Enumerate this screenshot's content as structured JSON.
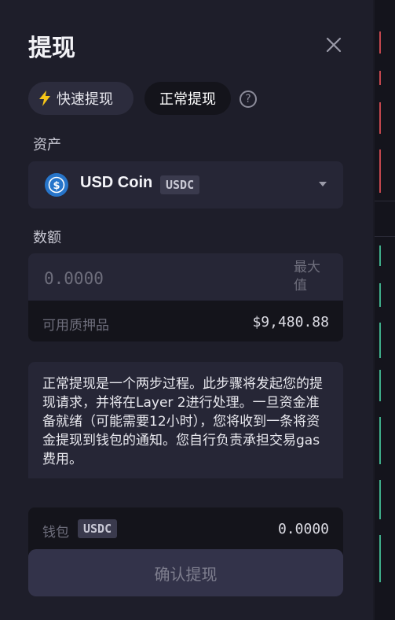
{
  "title": "提现",
  "tabs": {
    "fast_label": "快速提现",
    "normal_label": "正常提现"
  },
  "asset": {
    "label": "资产",
    "name": "USD Coin",
    "ticker": "USDC"
  },
  "amount": {
    "label": "数额",
    "placeholder": "0.0000",
    "max_label": "最大值"
  },
  "collateral": {
    "label": "可用质押品",
    "value": "$9,480.88"
  },
  "info_text": "正常提现是一个两步过程。此步骤将发起您的提现请求，并将在Layer 2进行处理。一旦资金准备就绪（可能需要12小时），您将收到一条将资金提现到钱包的通知。您自行负责承担交易gas费用。",
  "wallet": {
    "label": "钱包",
    "ticker": "USDC",
    "value": "0.0000"
  },
  "confirm_label": "确认提现",
  "colors": {
    "panel": "#1e1e2a",
    "accent_fast": "#f5c518",
    "usdc_blue": "#2775ca",
    "up": "#3fae8a",
    "down": "#c4474e"
  }
}
